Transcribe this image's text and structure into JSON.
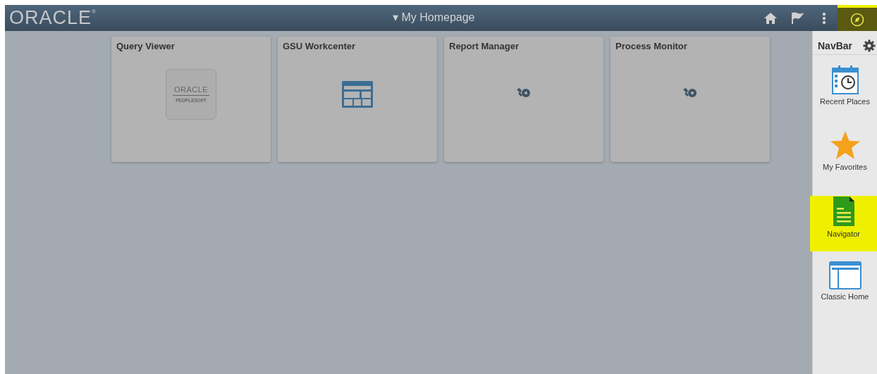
{
  "header": {
    "logo": "ORACLE",
    "logo_mark": "®",
    "title_caret": "▾",
    "title": "My Homepage",
    "buttons": [
      {
        "kind": "home",
        "highlighted": false
      },
      {
        "kind": "flag",
        "highlighted": false
      },
      {
        "kind": "more",
        "highlighted": false
      },
      {
        "kind": "navigator",
        "highlighted": true
      }
    ]
  },
  "tiles": [
    {
      "title": "Query Viewer",
      "kind": "peoplesoft",
      "logo_top": "ORACLE",
      "logo_bottom": "PEOPLESOFT"
    },
    {
      "title": "GSU Workcenter",
      "kind": "workcenter"
    },
    {
      "title": "Report Manager",
      "kind": "wrench"
    },
    {
      "title": "Process Monitor",
      "kind": "wrench"
    }
  ],
  "navbar": {
    "title": "NavBar",
    "items": [
      {
        "label": "Recent Places",
        "kind": "recent",
        "highlighted": false
      },
      {
        "label": "My Favorites",
        "kind": "favorites",
        "highlighted": false
      },
      {
        "label": "Navigator",
        "kind": "navigator",
        "highlighted": true
      },
      {
        "label": "Classic Home",
        "kind": "classic",
        "highlighted": false
      }
    ]
  }
}
